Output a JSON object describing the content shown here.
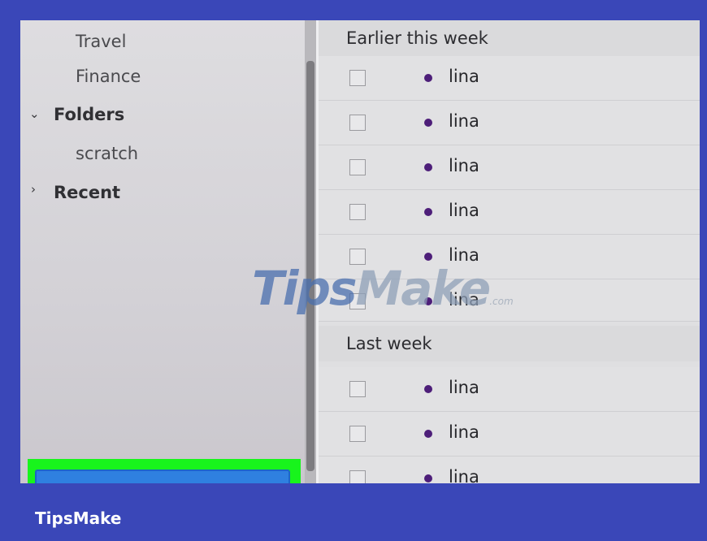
{
  "sidebar": {
    "items": [
      {
        "label": "Travel"
      },
      {
        "label": "Finance"
      },
      {
        "label": "Folders",
        "caret": "⌄"
      },
      {
        "label": "scratch"
      },
      {
        "label": "Recent",
        "caret": "›"
      }
    ]
  },
  "list": {
    "groups": [
      {
        "header": "Earlier this week",
        "rows": [
          "lina",
          "lina",
          "lina",
          "lina",
          "lina",
          "lina"
        ]
      },
      {
        "header": "Last week",
        "rows": [
          "lina",
          "lina",
          "lina"
        ]
      }
    ],
    "dot_color": "#4d1e79"
  },
  "watermark": {
    "part1": "Tips",
    "part2": "Make",
    "suffix": ".com"
  },
  "footer": {
    "brand": "TipsMake"
  },
  "colors": {
    "frame_border": "#3a47b8",
    "highlight": "#18f41c",
    "button": "#2f80e0"
  }
}
